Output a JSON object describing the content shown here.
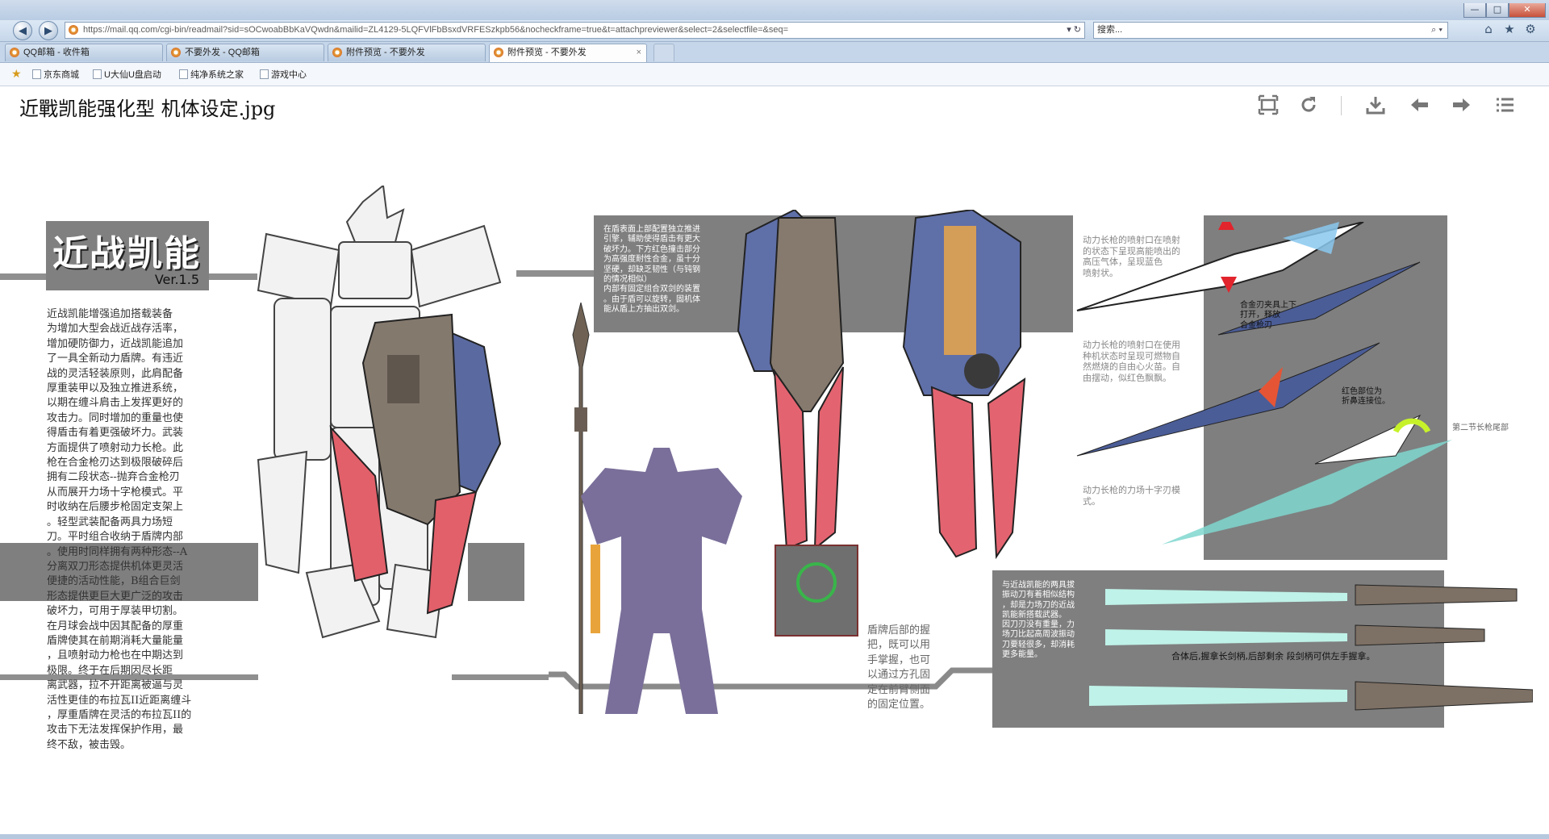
{
  "browser": {
    "url": "https://mail.qq.com/cgi-bin/readmail?sid=sOCwoabBbKaVQwdn&mailid=ZL4129-5LQFVlFbBsxdVRFESzkpb56&nocheckframe=true&t=attachpreviewer&select=2&selectfile=&seq=",
    "search_placeholder": "搜索...",
    "tabs": [
      {
        "label": "QQ邮箱 - 收件箱"
      },
      {
        "label": "不要外发 - QQ邮箱"
      },
      {
        "label": "附件预览 - 不要外发"
      },
      {
        "label": "附件预览 - 不要外发"
      }
    ],
    "tab_close": "×",
    "favorites": [
      {
        "label": "京东商城"
      },
      {
        "label": "U大仙U盘启动"
      },
      {
        "label": "纯净系统之家"
      },
      {
        "label": "游戏中心"
      }
    ],
    "window_controls": {
      "minimize": "—",
      "maximize": "□",
      "close": "✕"
    }
  },
  "viewer": {
    "file_title": "近戰凯能强化型 机体设定.jpg",
    "tools": [
      "fit-screen",
      "rotate",
      "download",
      "previous",
      "next",
      "menu"
    ]
  },
  "artwork": {
    "title": "近战凯能",
    "version": "Ver.1.5",
    "description": "近战凯能增强追加搭载装备\n为增加大型会战近战存活率，\n增加硬防御力，近战凯能追加\n了一具全新动力盾牌。有违近\n战的灵活轻装原则，此肩配备\n厚重装甲以及独立推进系统，\n以期在缠斗肩击上发挥更好的\n攻击力。同时增加的重量也使\n得盾击有着更强破坏力。武装\n方面提供了喷射动力长枪。此\n枪在合金枪刃达到极限破碎后\n拥有二段状态--抛弃合金枪刃\n从而展开力场十字枪模式。平\n时收纳在后腰步枪固定支架上\n。轻型武装配备两具力场短\n刀。平时组合收纳于盾牌内部\n。使用时同样拥有两种形态--A\n分离双刀形态提供机体更灵活\n便捷的活动性能，B组合巨剑\n形态提供更巨大更广泛的攻击\n破坏力，可用于厚装甲切割。\n在月球会战中因其配备的厚重\n盾牌使其在前期消耗大量能量\n，且喷射动力枪也在中期达到\n极限。终于在后期因尽长距\n离武器，拉不开距离被逼与灵\n活性更佳的布拉瓦II近距离缠斗\n，厚重盾牌在灵活的布拉瓦II的\n攻击下无法发挥保护作用，最\n终不敌，被击毁。",
    "shield_note": "在盾表面上部配置独立推进\n引擎，辅助使得盾击有更大\n破坏力。下方红色撞击部分\n为高强度耐性合金，虽十分\n坚硬，却缺乏韧性（与钝钢\n的情况相似）\n内部有固定组合双剑的装置\n。由于盾可以旋转，固机体\n能从盾上方抽出双剑。",
    "grip_note": "盾牌后部的握\n把，既可以用\n手掌握，也可\n以通过方孔固\n定在前臂侧面\n的固定位置。",
    "lance_note_1": "动力长枪的喷射口在喷射\n的状态下呈现高能喷出的\n高压气体，呈现蓝色\n喷射状。",
    "lance_note_2": "动力长枪的喷射口在使用\n种机状态时呈现可燃物自\n然燃烧的自由心火苗。自\n由摆动，似红色飘飘。",
    "lance_note_3": "动力长枪的力场十字刃模\n式。",
    "lance_label_alloy": "合金刃夹具上下\n打开，释放\n合金枪刃",
    "lance_label_red": "红色部位为\n折鼻连接位。",
    "lance_label_tail": "第二节长枪尾部",
    "sword_note": "与近战凯能的两具拔\n振动刀有着相似结构\n，却是力场刀的近战\n凯能新搭载武器。\n因刀刃没有重量，力\n场刀比起高周波振动\n刀要轻很多，却消耗\n更多能量。",
    "sword_label": "合体后,握拿长剑柄,后部剩余   段剑柄可供左手握拿。"
  }
}
